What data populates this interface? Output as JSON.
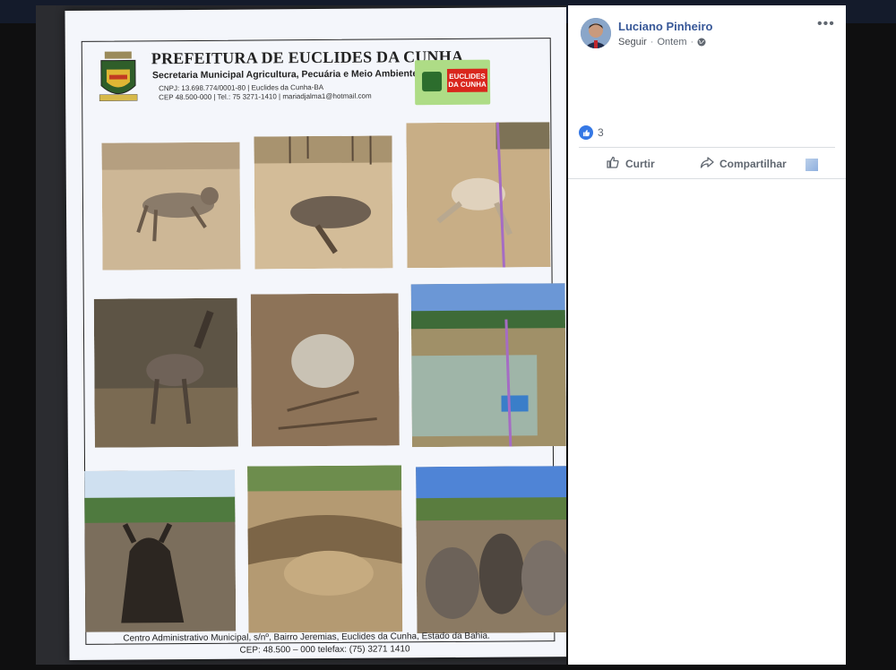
{
  "post": {
    "author": "Luciano Pinheiro",
    "follow_label": "Seguir",
    "time": "Ontem",
    "separator": "·",
    "more_label": "•••",
    "reaction_count": "3",
    "actions": {
      "like_label": "Curtir",
      "share_label": "Compartilhar"
    }
  },
  "document": {
    "title": "PREFEITURA DE EUCLIDES DA CUNHA",
    "subtitle": "Secretaria Municipal Agricultura, Pecuária e Meio Ambiente.",
    "line1": "CNPJ: 13.698.774/0001-80 | Euclides da Cunha-BA",
    "line2": "CEP 48.500-000 | Tel.: 75 3271-1410 | mariadjalma1@hotmail.com",
    "logo_text": "EUCLIDES DA CUNHA",
    "footer_line1": "Centro Administrativo Municipal, s/nº, Bairro Jeremias, Euclides da Cunha, Estado da Bahia.",
    "footer_line2": "CEP: 48.500 – 000 telefax: (75) 3271 1410"
  },
  "colors": {
    "brand_blue": "#385898",
    "like_blue": "#3578e5",
    "secondary_text": "#606770"
  },
  "icons": {
    "avatar": "avatar",
    "globe": "globe-icon",
    "like": "thumbs-up-icon",
    "share": "share-icon",
    "more": "more-options-icon"
  }
}
